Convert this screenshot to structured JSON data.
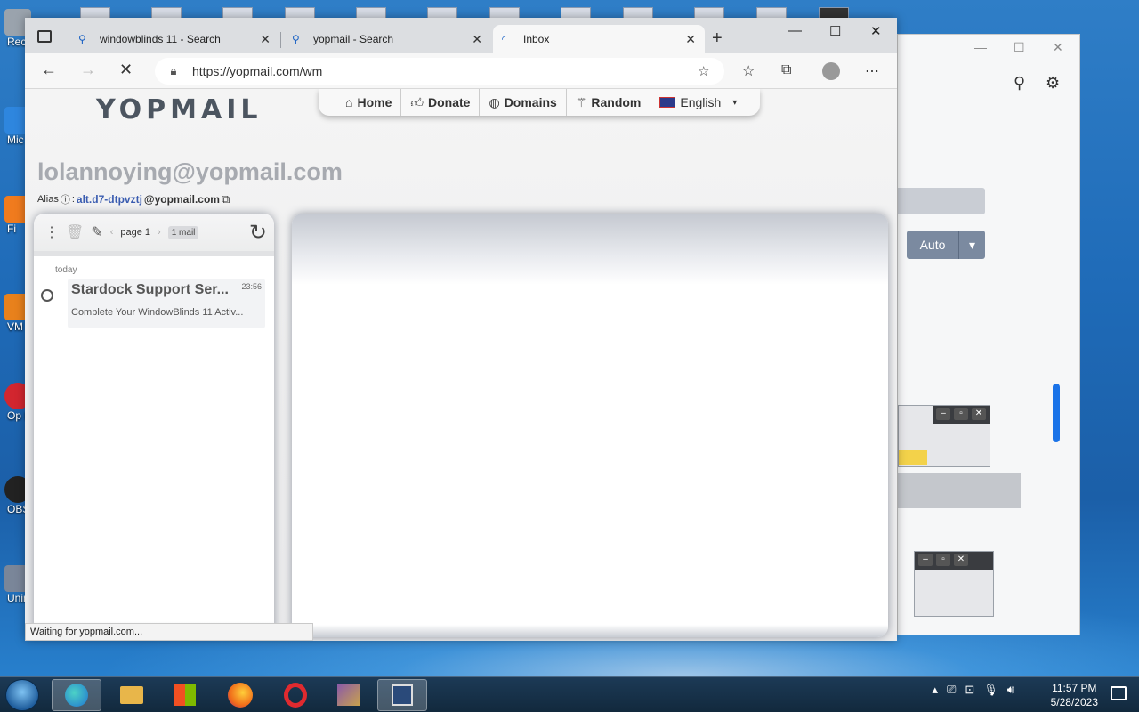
{
  "desktop": {
    "icon_labels": [
      "Recy",
      "Mic E",
      "Fi",
      "VM Wor",
      "Op Br",
      "OBS",
      "Unin"
    ]
  },
  "browser": {
    "tabs": [
      {
        "title": "windowblinds 11 - Search",
        "icon": "search-icon"
      },
      {
        "title": "yopmail - Search",
        "icon": "search-icon"
      },
      {
        "title": "Inbox",
        "icon": "loading-icon"
      }
    ],
    "url": "https://yopmail.com/wm",
    "status": "Waiting for yopmail.com..."
  },
  "page": {
    "logo": "YOPMAIL",
    "nav": [
      {
        "label": "Home",
        "icon": "home-icon"
      },
      {
        "label": "Donate",
        "icon": "thumbs-up-icon"
      },
      {
        "label": "Domains",
        "icon": "globe-icon"
      },
      {
        "label": "Random",
        "icon": "wand-icon"
      }
    ],
    "language": "English",
    "email": "lolannoying@yopmail.com",
    "alias_label": "Alias",
    "alias_address": "alt.d7-dtpvztj",
    "alias_domain": "@yopmail.com",
    "mailbox": {
      "page_label": "page 1",
      "count_label": "1 mail",
      "day_label": "today",
      "mails": [
        {
          "sender": "Stardock Support Ser...",
          "time": "23:56",
          "subject": "Complete Your WindowBlinds 11 Activ..."
        }
      ]
    }
  },
  "background_window": {
    "auto_label": "Auto"
  },
  "taskbar": {
    "time": "11:57 PM",
    "date": "5/28/2023"
  }
}
